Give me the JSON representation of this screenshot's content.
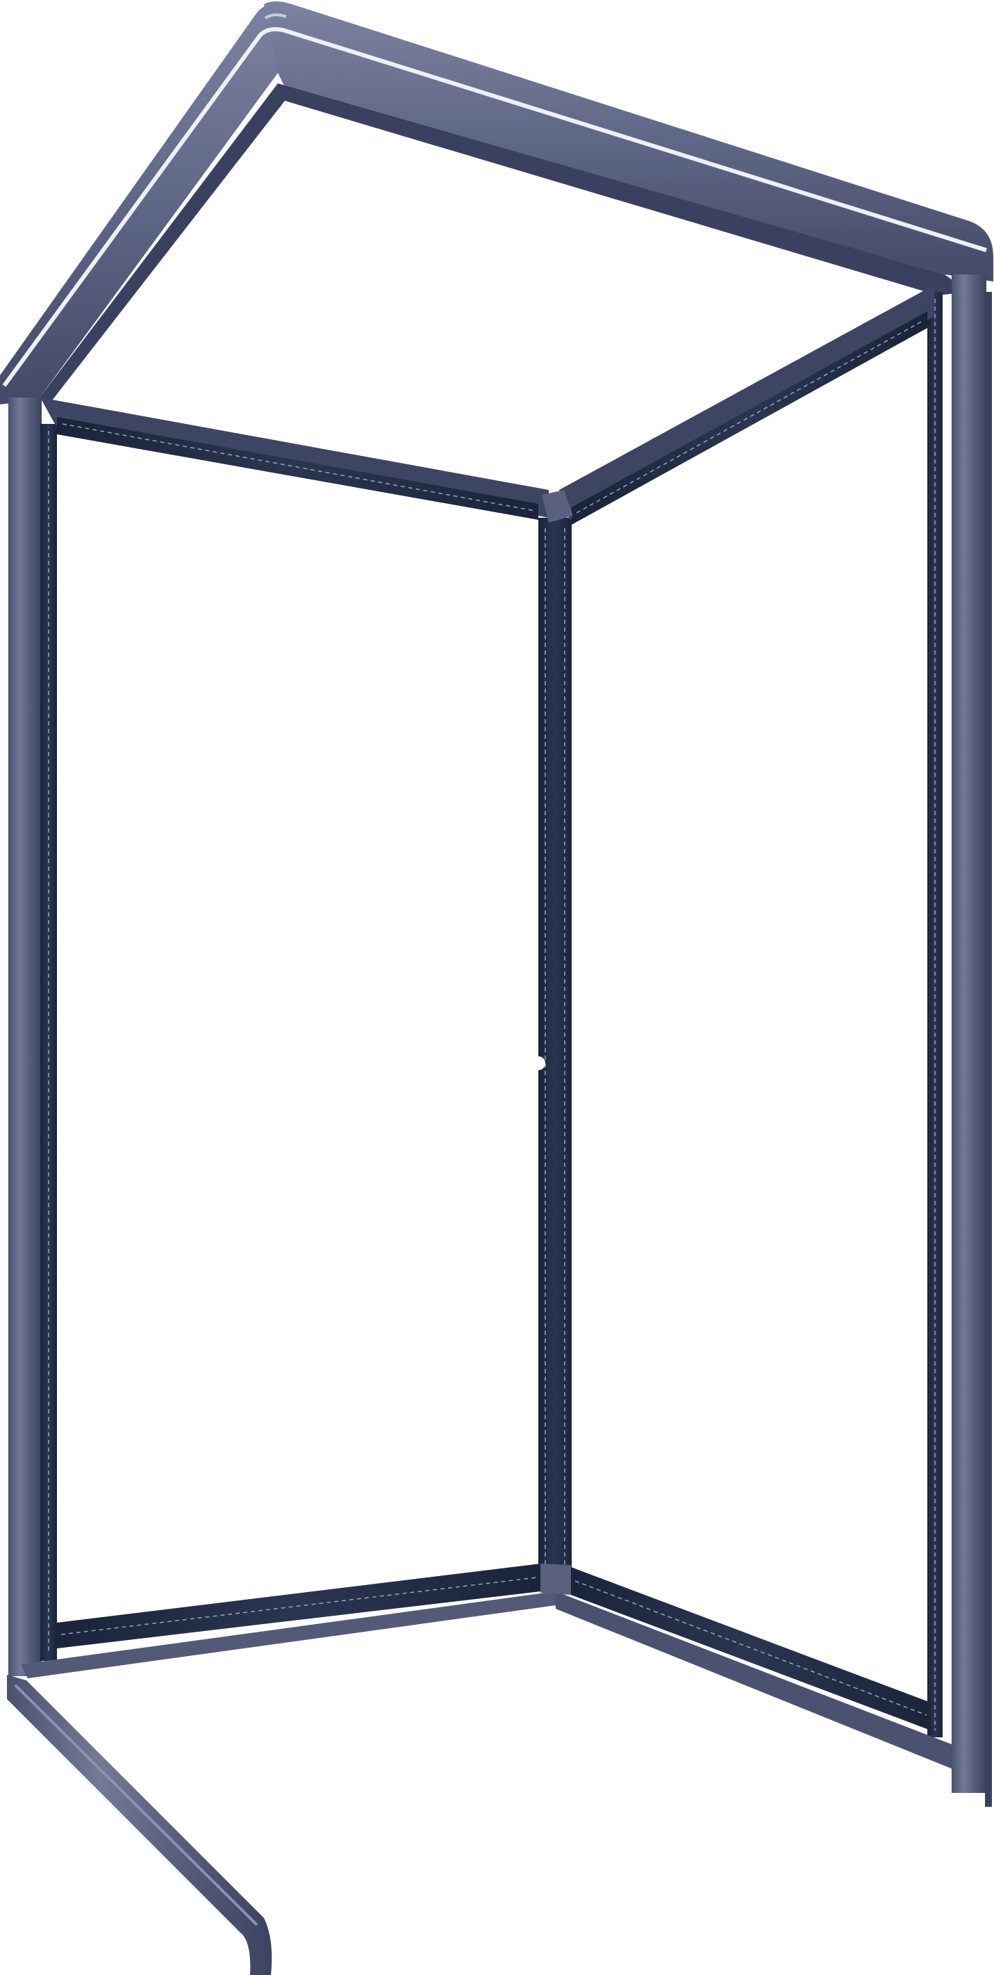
{
  "object": {
    "kind": "corner shower cabin frame",
    "colors": {
      "frame_dark": "#1f2b44",
      "frame_mid": "#3a4560",
      "metal_light": "#6e7590",
      "metal_mid": "#4f5774",
      "metal_shadow": "#2f3650",
      "highlight": "#e9ecf3",
      "stitch": "#9aa4bc"
    }
  }
}
